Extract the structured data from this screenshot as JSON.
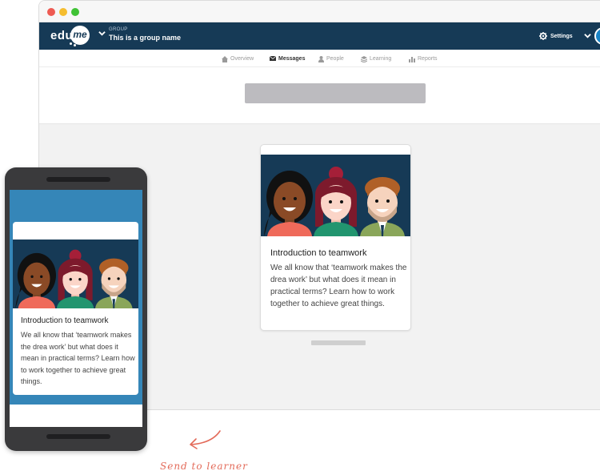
{
  "app": {
    "logo_text": "edu",
    "logo_badge": "me",
    "group_label": "GROUP",
    "group_name": "This is a group name",
    "settings_label": "Settings"
  },
  "tabs": [
    {
      "label": "Overview",
      "icon": "home-icon",
      "active": false
    },
    {
      "label": "Messages",
      "icon": "envelope-icon",
      "active": true
    },
    {
      "label": "People",
      "icon": "person-icon",
      "active": false
    },
    {
      "label": "Learning",
      "icon": "stack-icon",
      "active": false
    },
    {
      "label": "Reports",
      "icon": "bar-chart-icon",
      "active": false
    }
  ],
  "course_card": {
    "title": "Introduction to teamwork",
    "description": "We all know that ‘teamwork makes the drea work’ but what does it mean in practical terms? Learn how to work together to achieve great things."
  },
  "annotation": {
    "label": "Send to learner"
  },
  "colors": {
    "navy": "#163a56",
    "phone_blue": "#3586b8",
    "accent_coral": "#e36b5a"
  }
}
